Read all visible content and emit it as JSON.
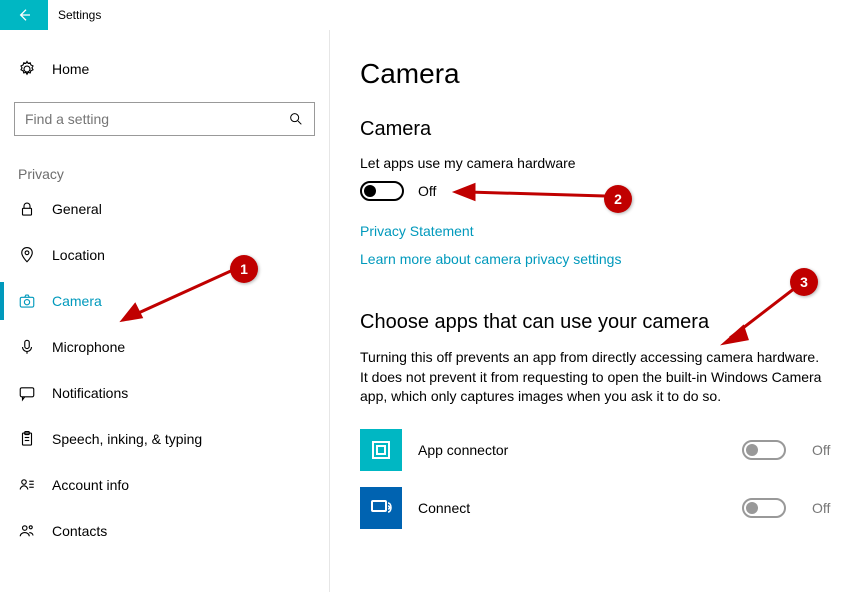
{
  "window": {
    "title": "Settings"
  },
  "sidebar": {
    "home_label": "Home",
    "search_placeholder": "Find a setting",
    "section": "Privacy",
    "items": [
      {
        "label": "General",
        "icon": "lock"
      },
      {
        "label": "Location",
        "icon": "location"
      },
      {
        "label": "Camera",
        "icon": "camera",
        "active": true
      },
      {
        "label": "Microphone",
        "icon": "microphone"
      },
      {
        "label": "Notifications",
        "icon": "notification"
      },
      {
        "label": "Speech, inking, & typing",
        "icon": "clipboard"
      },
      {
        "label": "Account info",
        "icon": "account"
      },
      {
        "label": "Contacts",
        "icon": "contacts"
      }
    ]
  },
  "main": {
    "heading": "Camera",
    "section1_title": "Camera",
    "toggle_label": "Let apps use my camera hardware",
    "toggle_state": "Off",
    "link_privacy": "Privacy Statement",
    "link_learn": "Learn more about camera privacy settings",
    "section2_title": "Choose apps that can use your camera",
    "section2_body": "Turning this off prevents an app from directly accessing camera hardware. It does not prevent it from requesting to open the built-in Windows Camera app, which only captures images when you ask it to do so.",
    "apps": [
      {
        "name": "App connector",
        "state": "Off"
      },
      {
        "name": "Connect",
        "state": "Off"
      }
    ]
  },
  "annotations": {
    "b1": "1",
    "b2": "2",
    "b3": "3"
  }
}
